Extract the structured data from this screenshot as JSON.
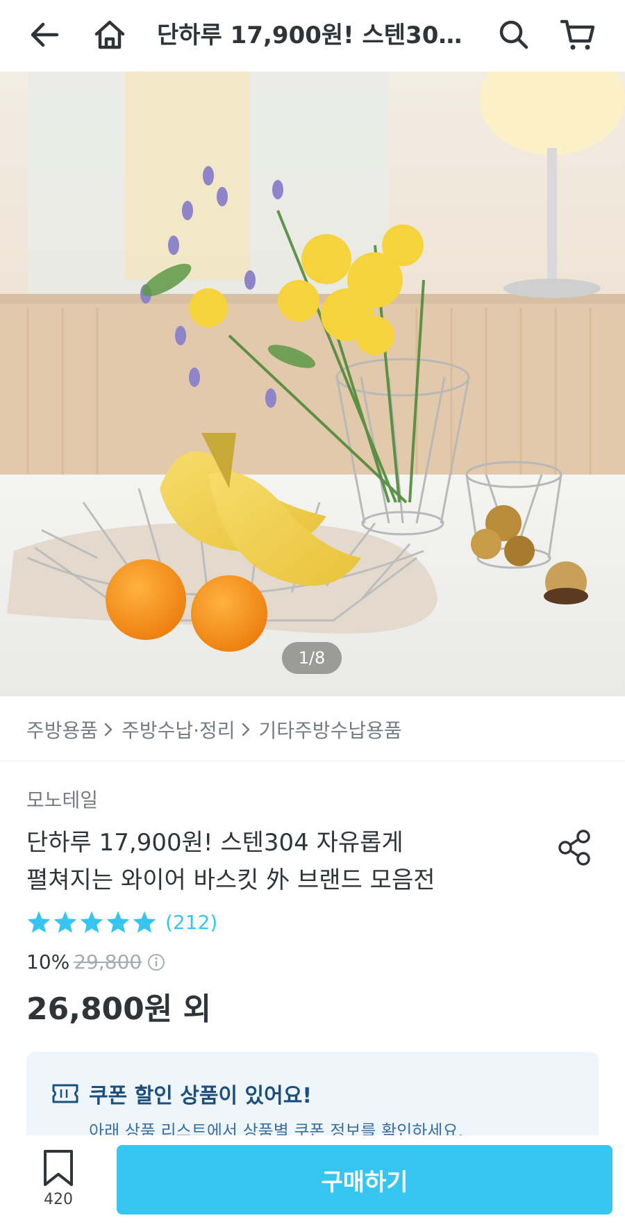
{
  "header": {
    "title": "단하루 17,900원! 스텐30…",
    "back_icon": "arrow-left-icon",
    "home_icon": "home-icon",
    "search_icon": "search-icon",
    "cart_icon": "cart-icon"
  },
  "hero": {
    "pager": "1/8"
  },
  "breadcrumb": {
    "items": [
      "주방용품",
      "주방수납·정리",
      "기타주방수납용품"
    ]
  },
  "product": {
    "brand": "모노테일",
    "title_line1": "단하루 17,900원! 스텐304 자유롭게",
    "title_line2": "펼쳐지는 와이어 바스킷 外 브랜드 모음전",
    "rating_stars": 5,
    "review_count": "(212)",
    "discount_pct": "10%",
    "original_price": "29,800",
    "price": "26,800원 외"
  },
  "coupon": {
    "title": "쿠폰 할인 상품이 있어요!",
    "desc": "아래 상품 리스트에서 상품별 쿠폰 정보를 확인하세요."
  },
  "bottom": {
    "bookmark_count": "420",
    "buy_label": "구매하기"
  },
  "colors": {
    "accent": "#35c5f0",
    "text": "#2f3438",
    "muted": "#757b80",
    "coupon_bg": "#eef6fc",
    "coupon_title": "#1a4f80"
  }
}
